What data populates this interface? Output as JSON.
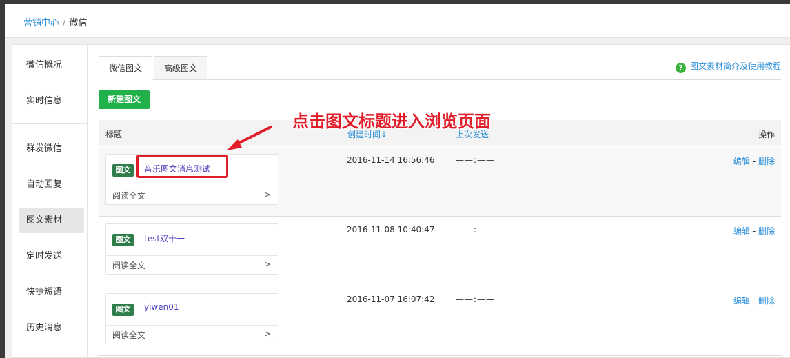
{
  "breadcrumb": {
    "root": "营销中心",
    "separator": "/",
    "current": "微信"
  },
  "sidebar": {
    "items": [
      {
        "label": "微信概况"
      },
      {
        "label": "实时信息"
      },
      {
        "label": "群发微信"
      },
      {
        "label": "自动回复"
      },
      {
        "label": "图文素材",
        "active": true
      },
      {
        "label": "定时发送"
      },
      {
        "label": "快捷短语"
      },
      {
        "label": "历史消息"
      }
    ]
  },
  "tabs": [
    {
      "label": "微信图文",
      "active": true
    },
    {
      "label": "高级图文"
    }
  ],
  "help_link": {
    "icon": "question-icon",
    "text": "图文素材简介及使用教程"
  },
  "new_button": {
    "label": "新建图文"
  },
  "table": {
    "columns": {
      "title": "标题",
      "created": "创建时间↓",
      "last_sent": "上次发送",
      "actions": "操作"
    },
    "rows": [
      {
        "badge": "图文",
        "title": "音乐图文消息测试",
        "read_full": "阅读全文",
        "chevron": ">",
        "created": "2016-11-14 16:56:46",
        "last_sent": "——:——",
        "edit": "编辑",
        "dash": "-",
        "delete": "删除"
      },
      {
        "badge": "图文",
        "title": "test双十一",
        "read_full": "阅读全文",
        "chevron": ">",
        "created": "2016-11-08 10:40:47",
        "last_sent": "——:——",
        "edit": "编辑",
        "dash": "-",
        "delete": "删除"
      },
      {
        "badge": "图文",
        "title": "yiwen01",
        "read_full": "阅读全文",
        "chevron": ">",
        "created": "2016-11-07 16:07:42",
        "last_sent": "——:——",
        "edit": "编辑",
        "dash": "-",
        "delete": "删除"
      }
    ]
  },
  "annotation": {
    "text": "点击图文标题进入浏览页面",
    "color": "#e01e2a"
  },
  "colors": {
    "accent_link": "#2a8ed8",
    "button_green": "#22b04a",
    "badge_green": "#2e7d4a",
    "title_link": "#4a3fbf"
  }
}
